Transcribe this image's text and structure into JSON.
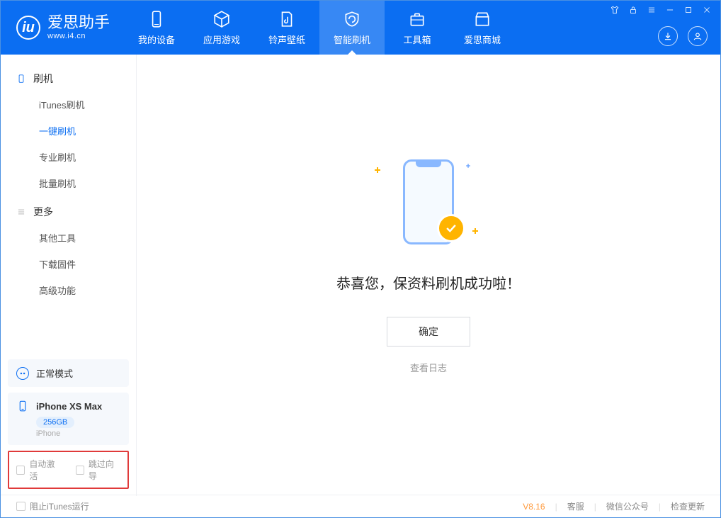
{
  "app": {
    "title": "爱思助手",
    "url": "www.i4.cn"
  },
  "tabs": {
    "device": "我的设备",
    "apps": "应用游戏",
    "ringtone": "铃声壁纸",
    "flash": "智能刷机",
    "toolbox": "工具箱",
    "store": "爱思商城"
  },
  "sidebar": {
    "sect_flash": "刷机",
    "items_flash": {
      "itunes": "iTunes刷机",
      "onekey": "一键刷机",
      "pro": "专业刷机",
      "batch": "批量刷机"
    },
    "sect_more": "更多",
    "items_more": {
      "other": "其他工具",
      "firmware": "下载固件",
      "advanced": "高级功能"
    }
  },
  "mode": {
    "label": "正常模式"
  },
  "device": {
    "name": "iPhone XS Max",
    "capacity": "256GB",
    "type": "iPhone"
  },
  "options": {
    "auto_activate": "自动激活",
    "skip_guide": "跳过向导"
  },
  "main": {
    "success": "恭喜您，保资料刷机成功啦！",
    "ok": "确定",
    "viewlog": "查看日志"
  },
  "status": {
    "block_itunes": "阻止iTunes运行",
    "version": "V8.16",
    "support": "客服",
    "wechat": "微信公众号",
    "update": "检查更新"
  }
}
